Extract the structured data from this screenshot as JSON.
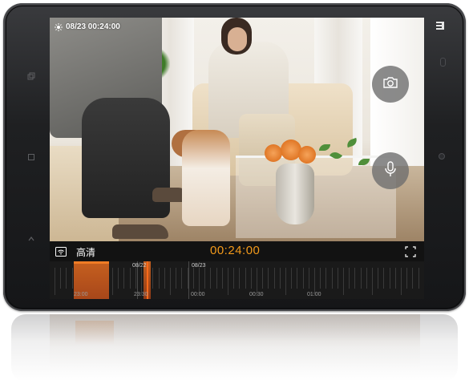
{
  "overlay": {
    "timestamp": "08/23 00:24:00",
    "weather_icon": "sun-icon"
  },
  "controls": {
    "hd_icon": "wifi-signal-icon",
    "hd_label": "高清",
    "current_time": "00:24:00",
    "fullscreen_icon": "fullscreen-icon",
    "snapshot_icon": "camera-icon",
    "voice_icon": "microphone-icon"
  },
  "timeline": {
    "date_marks": [
      "08/22",
      "08/23"
    ],
    "time_marks": [
      "23:00",
      "23:30",
      "00:00",
      "00:30",
      "01:00"
    ],
    "accent_color": "#f07c25"
  },
  "device": {
    "brand_mark": "mi-logo"
  }
}
